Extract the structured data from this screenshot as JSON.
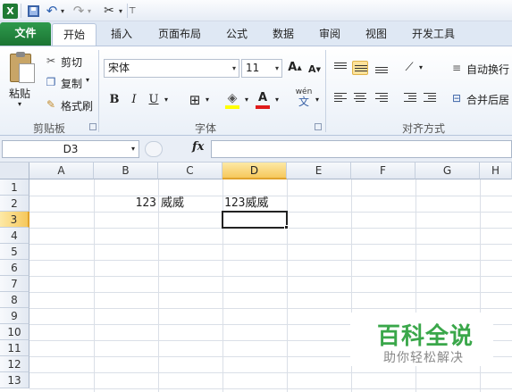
{
  "qat": {
    "app_icon": "X",
    "undo_icon": "↶",
    "redo_icon": "↷",
    "dropdown_icon": "▾",
    "tools_icon": "✂",
    "customize_icon": "⊤"
  },
  "tabs": [
    "文件",
    "开始",
    "插入",
    "页面布局",
    "公式",
    "数据",
    "审阅",
    "视图",
    "开发工具"
  ],
  "active_tab": "开始",
  "ribbon": {
    "clipboard": {
      "paste": "粘贴",
      "cut": "剪切",
      "copy": "复制",
      "format_painter": "格式刷",
      "group": "剪贴板"
    },
    "font": {
      "name": "宋体",
      "size": "11",
      "group": "字体",
      "bold": "B",
      "italic": "I",
      "underline": "U",
      "grow": "A",
      "shrink": "A",
      "wen": "wén",
      "wen_char": "文",
      "font_color_letter": "A"
    },
    "alignment": {
      "wrap_text": "自动换行",
      "merge_center": "合并后居",
      "group": "对齐方式"
    }
  },
  "formula_bar": {
    "name_box": "D3",
    "fx": "fx",
    "content": ""
  },
  "grid": {
    "columns": [
      "A",
      "B",
      "C",
      "D",
      "E",
      "F",
      "G",
      "H"
    ],
    "selected_column": "D",
    "rows": [
      "1",
      "2",
      "3",
      "4",
      "5",
      "6",
      "7",
      "8",
      "9",
      "10",
      "11",
      "12",
      "13"
    ],
    "selected_row": "3",
    "cells": {
      "B2": "123",
      "C2": "威威",
      "D2": "123威威"
    },
    "active_cell": "D3"
  },
  "watermark": {
    "title": "百科全说",
    "subtitle": "助你轻松解决"
  }
}
